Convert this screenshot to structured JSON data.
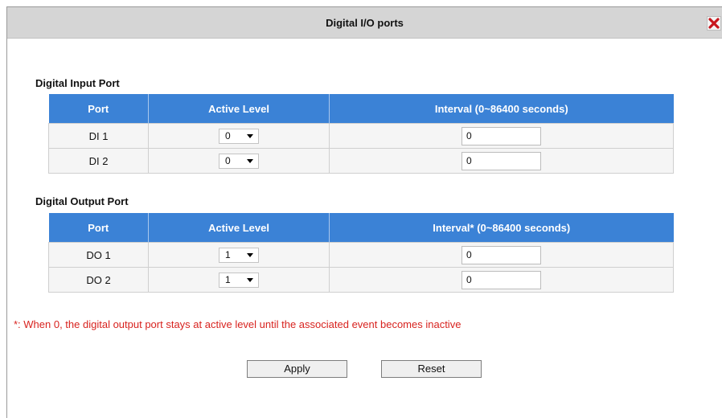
{
  "dialog": {
    "title": "Digital I/O ports",
    "close_icon": "close-x-icon"
  },
  "input_section": {
    "heading": "Digital Input Port",
    "headers": [
      "Port",
      "Active Level",
      "Interval (0~86400 seconds)"
    ],
    "rows": [
      {
        "port": "DI 1",
        "active_level": "0",
        "interval": "0"
      },
      {
        "port": "DI 2",
        "active_level": "0",
        "interval": "0"
      }
    ]
  },
  "output_section": {
    "heading": "Digital Output Port",
    "headers": [
      "Port",
      "Active Level",
      "Interval* (0~86400 seconds)"
    ],
    "rows": [
      {
        "port": "DO 1",
        "active_level": "1",
        "interval": "0"
      },
      {
        "port": "DO 2",
        "active_level": "1",
        "interval": "0"
      }
    ]
  },
  "note": "*: When 0, the digital output port stays at active level until the associated event becomes inactive",
  "buttons": {
    "apply": "Apply",
    "reset": "Reset"
  },
  "colors": {
    "header_blue": "#3b82d6",
    "note_red": "#d8231f",
    "close_red": "#c8161d"
  }
}
